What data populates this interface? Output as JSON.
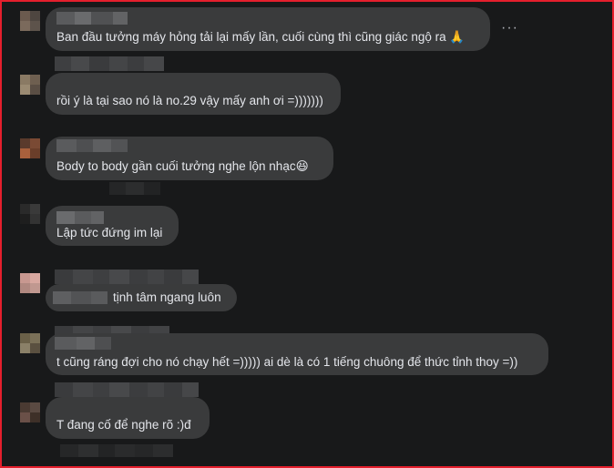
{
  "comments": [
    {
      "text": "Ban đầu tưởng máy hỏng tải lại mấy lần, cuối cùng thì cũng giác ngộ ra",
      "emoji": "🙏"
    },
    {
      "text": "rồi ý là tại sao nó là no.29 vậy mấy anh ơi =)))))))"
    },
    {
      "text": "Body to body gần cuối tưởng nghe lộn nhạc",
      "emoji": "😆"
    },
    {
      "text": "Lập tức đứng im lại"
    },
    {
      "text": "tịnh tâm ngang luôn"
    },
    {
      "text": "t cũng ráng đợi cho nó chạy hết =))))) ai dè là có 1 tiếng chuông để thức tỉnh thoy =))"
    },
    {
      "text": "T đang cố để nghe rõ :)đ"
    }
  ],
  "more_options": "···",
  "colors": {
    "frame": "#e41f2d",
    "bubble": "#3a3b3c",
    "background": "#18191a",
    "text": "#e4e6eb"
  }
}
